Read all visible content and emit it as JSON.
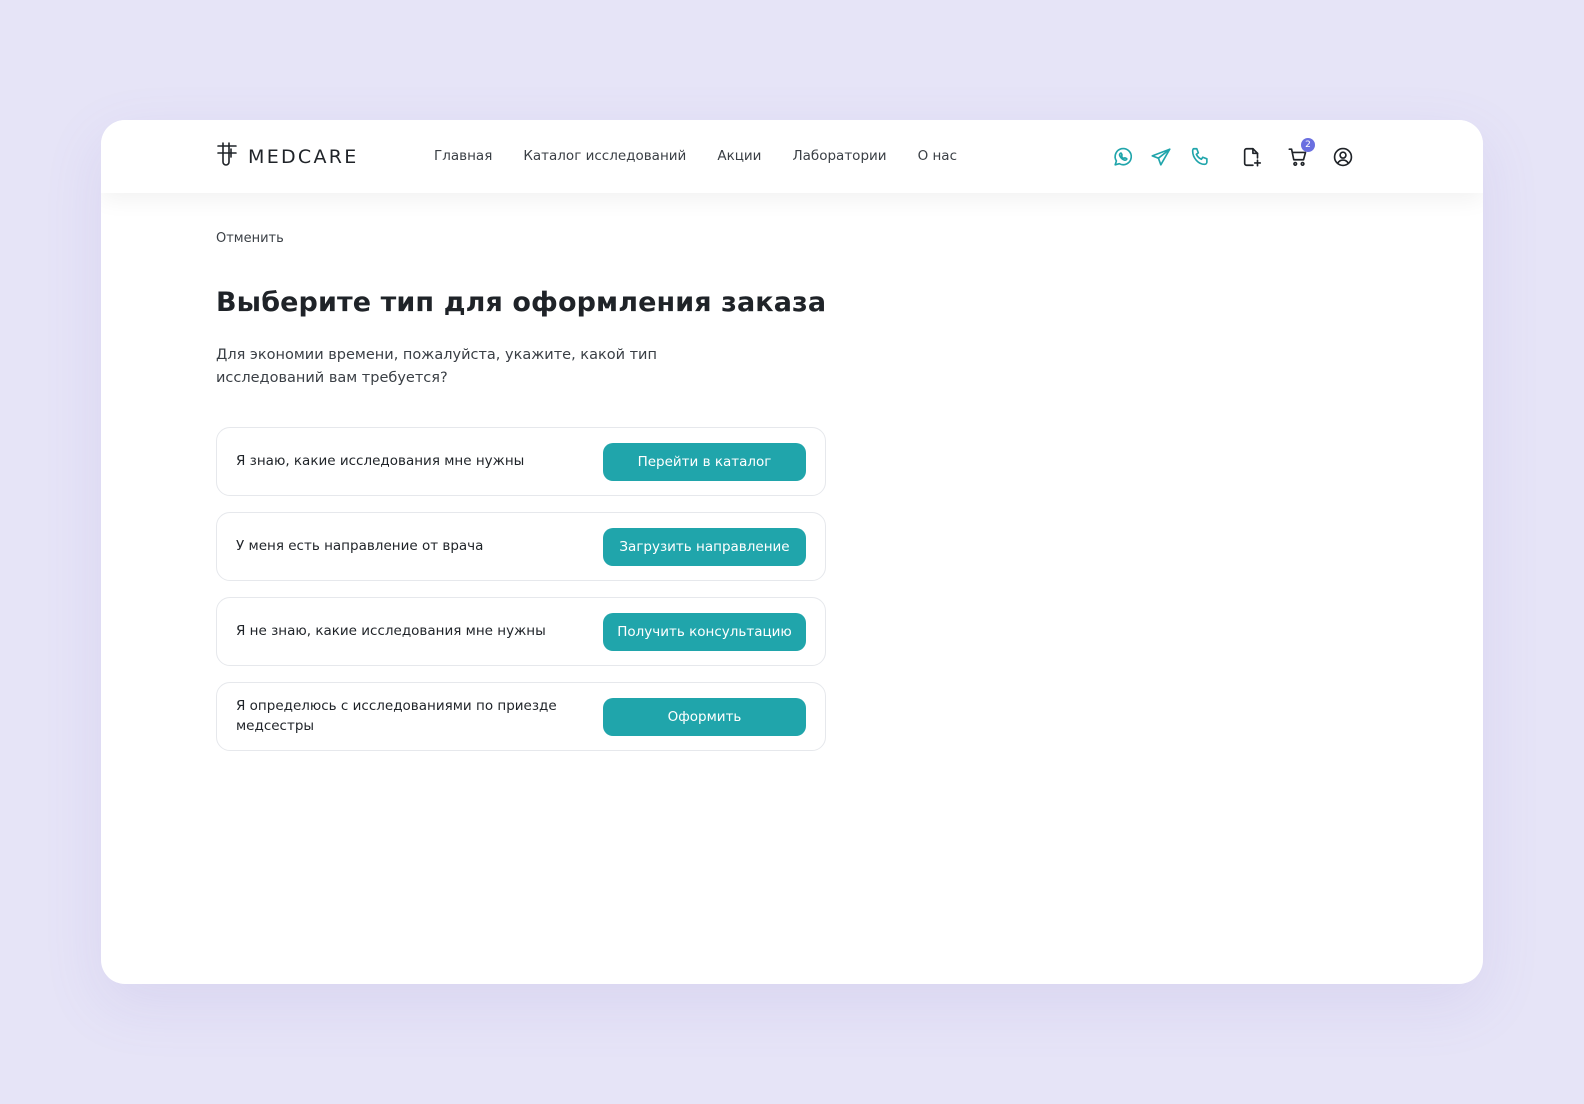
{
  "colors": {
    "accent": "#20a5ab",
    "badge": "#6a6fe0",
    "text": "#1f2328"
  },
  "brand": {
    "name": "MEDCARE",
    "logo_icon": "test-tube-icon"
  },
  "nav": {
    "items": [
      {
        "label": "Главная"
      },
      {
        "label": "Каталог исследований"
      },
      {
        "label": "Акции"
      },
      {
        "label": "Лаборатории"
      },
      {
        "label": "О нас"
      }
    ]
  },
  "header_icons": {
    "whatsapp": "whatsapp-icon",
    "telegram": "telegram-icon",
    "phone": "phone-icon",
    "document": "document-add-icon",
    "cart": "cart-icon",
    "cart_count": "2",
    "profile": "user-icon"
  },
  "page": {
    "cancel_label": "Отменить",
    "title": "Выберите тип для оформления заказа",
    "subtitle": "Для экономии времени, пожалуйста, укажите, какой тип исследований вам требуется?"
  },
  "options": [
    {
      "label": "Я знаю, какие исследования мне нужны",
      "button": "Перейти в каталог"
    },
    {
      "label": "У меня есть направление от врача",
      "button": "Загрузить направление"
    },
    {
      "label": "Я не знаю, какие исследования мне нужны",
      "button": "Получить консультацию"
    },
    {
      "label": "Я определюсь с исследованиями по приезде медсестры",
      "button": "Оформить"
    }
  ]
}
